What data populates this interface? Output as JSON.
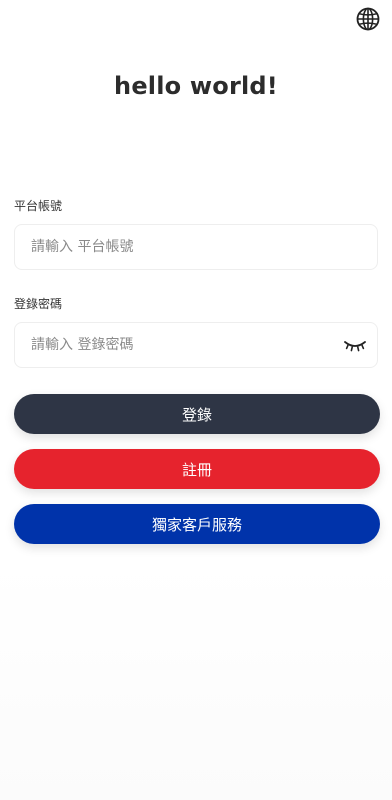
{
  "header": {
    "title": "hello world!",
    "language_icon": "globe-icon"
  },
  "form": {
    "account": {
      "label": "平台帳號",
      "placeholder": "請輸入 平台帳號",
      "value": ""
    },
    "password": {
      "label": "登錄密碼",
      "placeholder": "請輸入 登錄密碼",
      "value": "",
      "toggle_icon": "eye-closed-icon"
    }
  },
  "buttons": {
    "login": "登錄",
    "register": "註冊",
    "support": "獨家客戶服務"
  },
  "colors": {
    "login": "#2e3545",
    "register": "#e6232d",
    "support": "#0033aa"
  }
}
